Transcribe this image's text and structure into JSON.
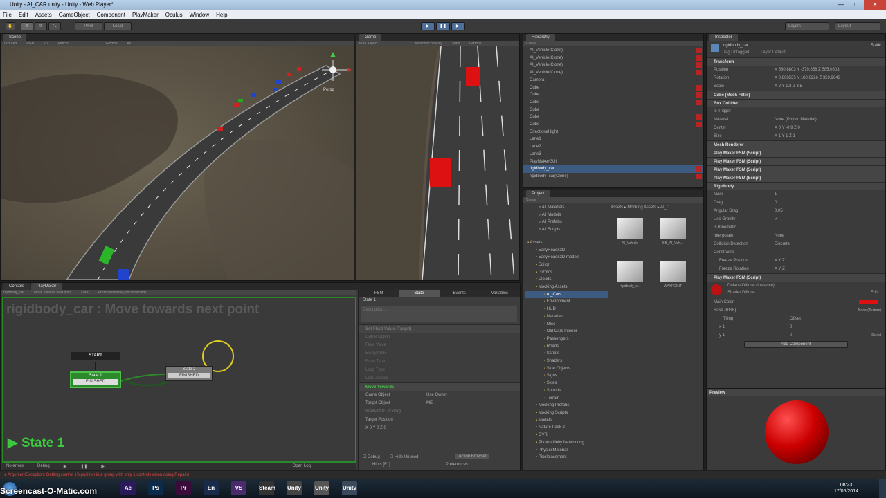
{
  "window": {
    "title": "Unity - AI_CAR.unity - Unity - Web Player*"
  },
  "menu": [
    "File",
    "Edit",
    "Assets",
    "GameObject",
    "Component",
    "PlayMaker",
    "Oculus",
    "Window",
    "Help"
  ],
  "toolbar": {
    "pivot": "Pivot",
    "local": "Local",
    "layers": "Layers",
    "layout": "Layout"
  },
  "scene": {
    "tab": "Scene",
    "shading": "Textured",
    "rgb": "RGB",
    "mode": "2D",
    "effects": "Effects",
    "gizmos": "Gizmos",
    "all": "All",
    "persp": "Persp"
  },
  "game": {
    "tab": "Game",
    "aspect": "Free Aspect",
    "maximize": "Maximize on Play",
    "stats": "Stats",
    "gizmos": "Gizmos"
  },
  "hierarchy": {
    "tab": "Hierarchy",
    "create": "Create",
    "items": [
      {
        "label": "AI_Vehicle(Clone)",
        "red": true
      },
      {
        "label": "AI_Vehicle(Clone)",
        "red": true
      },
      {
        "label": "AI_Vehicle(Clone)",
        "red": true
      },
      {
        "label": "AI_Vehicle(Clone)",
        "red": true
      },
      {
        "label": "Camera",
        "red": false
      },
      {
        "label": "Cube",
        "red": true
      },
      {
        "label": "Cube",
        "red": true
      },
      {
        "label": "Cube",
        "red": true
      },
      {
        "label": "Cube",
        "red": false
      },
      {
        "label": "Cube",
        "red": true
      },
      {
        "label": "Cube",
        "red": true
      },
      {
        "label": "Directional light",
        "red": false
      },
      {
        "label": "Lane1",
        "red": false
      },
      {
        "label": "Lane2",
        "red": false
      },
      {
        "label": "Lane3",
        "red": false
      },
      {
        "label": "PlayMakerGUI",
        "red": false
      },
      {
        "label": "rigidbody_car",
        "red": true,
        "sel": true
      },
      {
        "label": "rigidbody_car(Clone)",
        "red": true
      }
    ]
  },
  "project": {
    "tab": "Project",
    "create": "Create",
    "path": "Assets ▸ Mocking Assets ▸ AI_C",
    "favorites": [
      "All Materials",
      "All Models",
      "All Prefabs",
      "All Scripts"
    ],
    "folders": [
      "Assets",
      "EasyRoads3D",
      "EasyRoads3D models",
      "Editor",
      "Gizmos",
      "Clouds",
      "Mocking Assets",
      "AI_Cars",
      "Environment",
      "HUD",
      "Materials",
      "Misc",
      "Old Cars Interior",
      "Passengers",
      "Roads",
      "Scripts",
      "Shaders",
      "Side Objects",
      "Signs",
      "Skies",
      "Sounds",
      "Terrain",
      "Mocking Prefabs",
      "Mocking Scripts",
      "Models",
      "Nature Pack 2",
      "OVR",
      "Photon Unity Networking",
      "PhysicsMaterial",
      "Pixelplacement"
    ],
    "assets": [
      "AI_Vehicle",
      "BB_AI_Veh...",
      "rigidbody_c...",
      "WAYPOINT"
    ]
  },
  "inspector": {
    "tab": "Inspector",
    "object": "rigidbody_car",
    "static": "Static",
    "tag_label": "Tag",
    "tag": "Untagged",
    "layer_label": "Layer",
    "layer": "Default",
    "transform": {
      "title": "Transform",
      "position": "Position",
      "position_val": "X 580.8803   Y -379.858   Z 585.0803",
      "rotation": "Rotation",
      "rotation_val": "X 0.868535   Y 180.6226   Z 359.9643",
      "scale": "Scale",
      "scale_val": "X 2   Y 1.8   Z 3.5"
    },
    "mesh_filter": "Cube (Mesh Filter)",
    "box_collider": {
      "title": "Box Collider",
      "is_trigger": "Is Trigger",
      "material": "Material",
      "material_val": "None (Physic Material)",
      "center": "Center",
      "center_val": "X 0   Y -0.9   Z 0",
      "size": "Size",
      "size_val": "X 1   Y 1   Z 1"
    },
    "mesh_renderer": "Mesh Renderer",
    "fsm": [
      "Play Maker FSM (Script)",
      "Play Maker FSM (Script)",
      "Play Maker FSM (Script)",
      "Play Maker FSM (Script)"
    ],
    "rigidbody": {
      "title": "Rigidbody",
      "mass": "Mass",
      "mass_val": "1",
      "drag": "Drag",
      "drag_val": "0",
      "angular_drag": "Angular Drag",
      "angular_val": "0.05",
      "use_gravity": "Use Gravity",
      "is_kinematic": "Is Kinematic",
      "interpolate": "Interpolate",
      "interpolate_val": "None",
      "collision": "Collision Detection",
      "collision_val": "Discrete",
      "constraints": "Constraints",
      "freeze_pos": "Freeze Position",
      "freeze_rot": "Freeze Rotation",
      "freeze_pos_val": "X  Y  Z",
      "freeze_rot_val": "X  Y  Z"
    },
    "fsm5": "Play Maker FSM (Script)",
    "material": "Default-Diffuse (Instance)",
    "shader_label": "Shader",
    "shader": "Diffuse",
    "edit": "Edit...",
    "main_color": "Main Color",
    "base": "Base (RGB)",
    "tiling": "Tiling",
    "offset": "Offset",
    "texture": "None (Texture)",
    "select": "Select",
    "tx": "x 1",
    "ty": "y 1",
    "ox": "0",
    "oy": "0",
    "add_component": "Add Component",
    "preview": "Preview"
  },
  "playmaker": {
    "tab_console": "Console",
    "tab_pm": "PlayMaker",
    "fsm_selector": "rigidbody_car",
    "state_selector": "Move towards next point",
    "lock": "Lock",
    "prefab": "Prefab Instance (disconnected)",
    "title": "rigidbody_car : Move towards next point",
    "start": "START",
    "state1": "State 1",
    "state1_event": "FINISHED",
    "state2": "State 2",
    "state2_event": "FINISHED",
    "current": "State 1",
    "hints": "No errors",
    "debug": "Debug"
  },
  "pm_inspector": {
    "tabs": [
      "FSM",
      "State",
      "Events",
      "Variables"
    ],
    "state_name": "State 1",
    "description": "Description...",
    "action1": "Set Float Value (Target)",
    "action1_rows": [
      "Game Object",
      "Float Value",
      "Everyframe",
      "Ease Type",
      "Loop Type",
      "Look Ahead"
    ],
    "action2": "Move Towards",
    "game_object": "Game Object",
    "game_object_val": "Use Owner",
    "target_object": "Target Object",
    "target_object_val": "ME",
    "waypoint": "WAYPOINT(Clone)",
    "target_position": "Target Position",
    "tp_val": "X 0   Y 0   Z 0",
    "debug": "Debug",
    "hide_unused": "Hide Unused",
    "action_browser": "Action Browser",
    "hints": "Hints [F1]",
    "preferences": "Preferences",
    "open_log": "Open Log"
  },
  "status": {
    "error": "ArgumentException: Getting control 1's position in a group with only 1 controls when doing Repaint"
  },
  "taskbar": {
    "watermark": "Screencast-O-Matic.com",
    "time": "08:23",
    "date": "17/05/2014"
  },
  "taskbar_apps": [
    "Ae",
    "Ps",
    "Pr",
    "En",
    "VS",
    "Steam",
    "Unity",
    "Unity",
    "Unity"
  ],
  "colors": {
    "accent": "#3d5a80",
    "green": "#2a9a2a",
    "red": "#cc1111",
    "cursor": "#ddcc22"
  }
}
